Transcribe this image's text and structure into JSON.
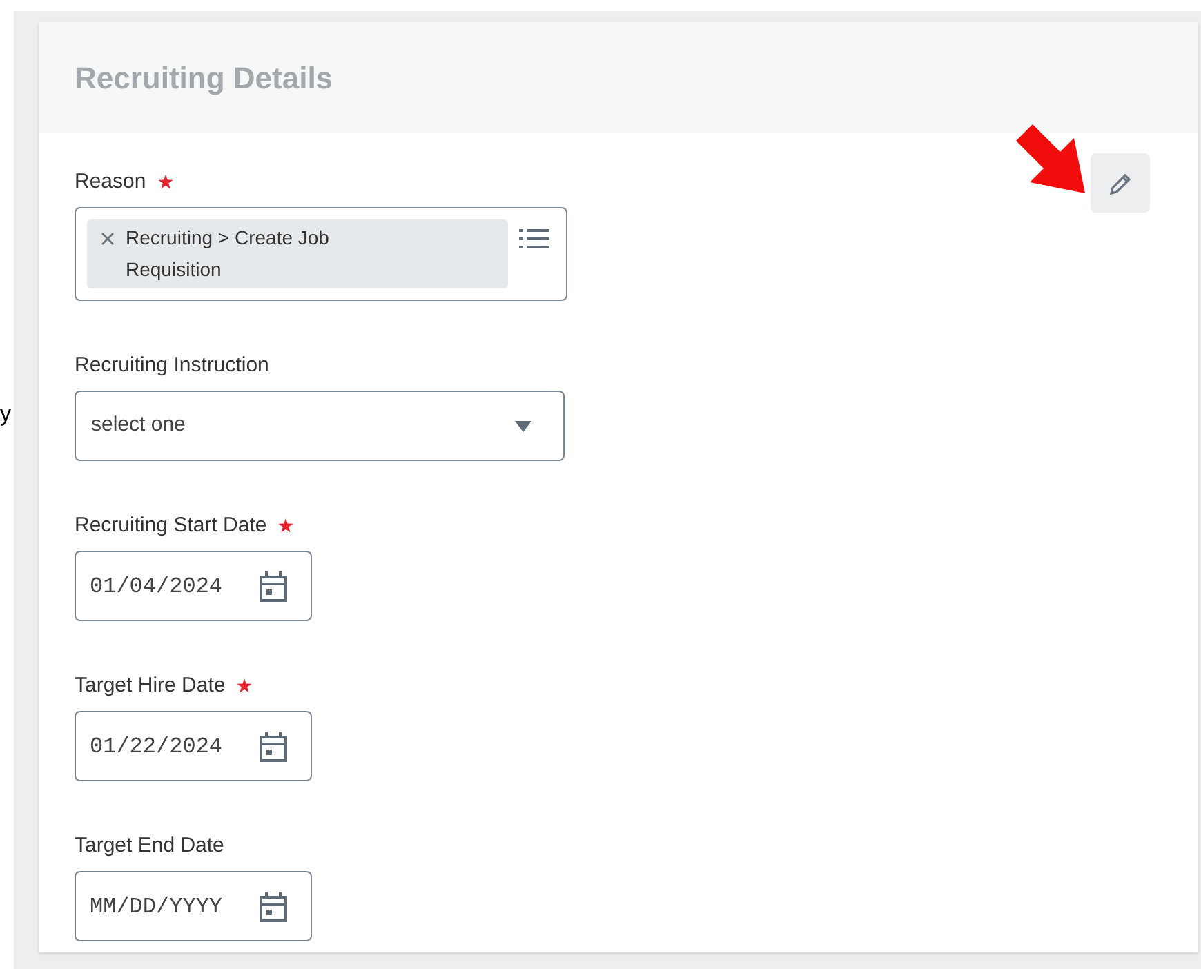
{
  "edge_fragment": "y",
  "panel": {
    "title": "Recruiting Details"
  },
  "fields": [
    {
      "kind": "multiselect",
      "label": "Reason",
      "required": true,
      "chips": [
        "Recruiting > Create Job Requisition"
      ]
    },
    {
      "kind": "dropdown",
      "label": "Recruiting Instruction",
      "required": false,
      "value": "select one"
    },
    {
      "kind": "date",
      "label": "Recruiting Start Date",
      "required": true,
      "value": "01/04/2024"
    },
    {
      "kind": "date",
      "label": "Target Hire Date",
      "required": true,
      "value": "01/22/2024"
    },
    {
      "kind": "date",
      "label": "Target End Date",
      "required": false,
      "placeholder": "MM/DD/YYYY"
    }
  ]
}
